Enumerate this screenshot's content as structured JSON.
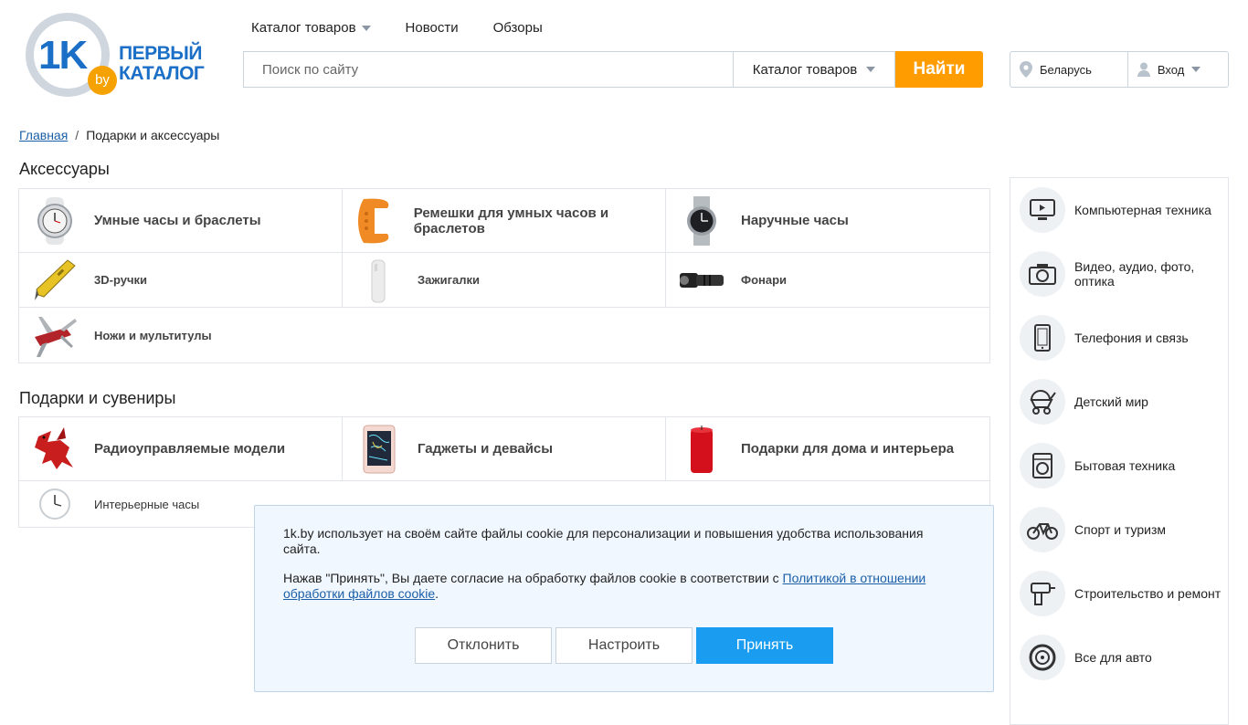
{
  "logo": {
    "main": "1K",
    "badge": "by",
    "line1": "ПЕРВЫЙ",
    "line2": "КАТАЛОГ"
  },
  "topnav": {
    "catalog": "Каталог товаров",
    "news": "Новости",
    "reviews": "Обзоры"
  },
  "search": {
    "placeholder": "Поиск по сайту",
    "category": "Каталог товаров",
    "button": "Найти"
  },
  "user_bar": {
    "region": "Беларусь",
    "login": "Вход"
  },
  "breadcrumb": {
    "home": "Главная",
    "separator": "/",
    "current": "Подарки и аксессуары"
  },
  "sections": [
    {
      "title": "Аксессуары",
      "items": [
        "Умные часы и браслеты",
        "Ремешки для умных часов и браслетов",
        "Наручные часы",
        "3D-ручки",
        "Зажигалки",
        "Фонари",
        "Ножи и мультитулы"
      ]
    },
    {
      "title": "Подарки и сувениры",
      "items": [
        "Радиоуправляемые модели",
        "Гаджеты и девайсы",
        "Подарки для дома и интерьера",
        "Интерьерные часы"
      ]
    }
  ],
  "sidebar": {
    "items": [
      {
        "label": "Компьютерная техника",
        "icon": "computer-icon"
      },
      {
        "label": "Видео, аудио, фото, оптика",
        "icon": "camera-icon"
      },
      {
        "label": "Телефония и связь",
        "icon": "phone-icon"
      },
      {
        "label": "Детский мир",
        "icon": "stroller-icon"
      },
      {
        "label": "Бытовая техника",
        "icon": "washer-icon"
      },
      {
        "label": "Спорт и туризм",
        "icon": "bicycle-icon"
      },
      {
        "label": "Строительство и ремонт",
        "icon": "drill-icon"
      },
      {
        "label": "Все для авто",
        "icon": "wheel-icon"
      }
    ]
  },
  "cookie": {
    "text1": "1k.by использует на своём сайте файлы cookie для персонализации и повышения удобства использования сайта.",
    "text2": "Нажав \"Принять\", Вы даете согласие на обработку файлов cookie в соответствии с ",
    "link": "Политикой в отношении обработки файлов cookie",
    "text2_end": ".",
    "decline": "Отклонить",
    "configure": "Настроить",
    "accept": "Принять"
  },
  "colors": {
    "brand_blue": "#1b6fc6",
    "search_orange": "#ff9c00",
    "accept_blue": "#1a9cf0",
    "link": "#1b5fa8"
  }
}
